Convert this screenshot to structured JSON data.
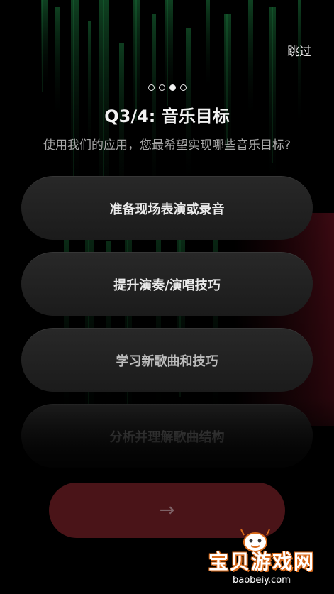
{
  "header": {
    "skip_label": "跳过"
  },
  "progress": {
    "total_steps": 4,
    "current_step": 3
  },
  "question": {
    "title": "Q3/4: 音乐目标",
    "subtitle": "使用我们的应用，您最希望实现哪些音乐目标?"
  },
  "options": [
    {
      "label": "准备现场表演或录音"
    },
    {
      "label": "提升演奏/演唱技巧"
    },
    {
      "label": "学习新歌曲和技巧"
    },
    {
      "label": "分析并理解歌曲结构"
    }
  ],
  "next_button": {
    "icon": "arrow-right-icon",
    "enabled": false
  },
  "watermark": {
    "brand": "宝贝游戏网",
    "url": "baobeiy.com"
  },
  "colors": {
    "background": "#000000",
    "option_bg": "#242424",
    "next_button_bg": "#4a1418",
    "accent_green": "#2fd06a",
    "accent_red": "#c0203a"
  }
}
